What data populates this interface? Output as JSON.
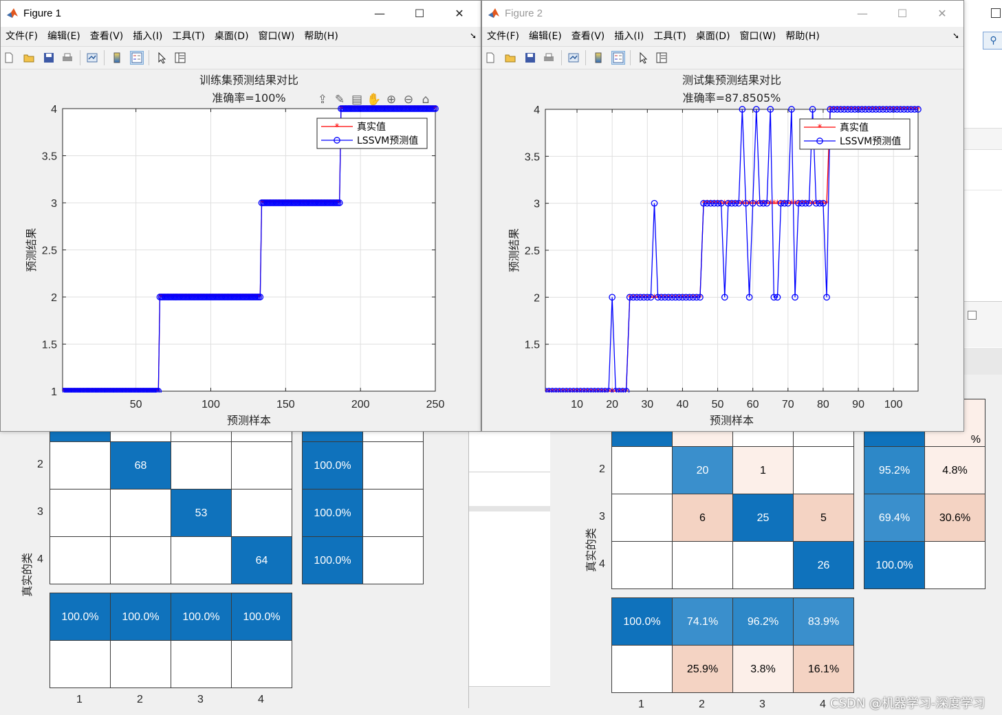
{
  "figure1": {
    "title": "Figure 1",
    "menu": [
      "文件(F)",
      "编辑(E)",
      "查看(V)",
      "插入(I)",
      "工具(T)",
      "桌面(D)",
      "窗口(W)",
      "帮助(H)"
    ],
    "toolbar_icons": [
      "new-figure-icon",
      "open-icon",
      "save-icon",
      "print-icon",
      "link-plot-icon",
      "colorbar-icon",
      "legend-icon",
      "pointer-icon",
      "property-inspector-icon"
    ],
    "axes_toolbar_icons": [
      "export-icon",
      "brush-icon",
      "data-tips-icon",
      "pan-icon",
      "zoom-in-icon",
      "zoom-out-icon",
      "home-icon"
    ],
    "plot_title": "训练集预测结果对比",
    "plot_subtitle": "准确率=100%",
    "xlabel": "预测样本",
    "ylabel": "预测结果",
    "xticks": [
      "50",
      "100",
      "150",
      "200",
      "250"
    ],
    "yticks": [
      "1",
      "1.5",
      "2",
      "2.5",
      "3",
      "3.5",
      "4"
    ],
    "legend": [
      "真实值",
      "LSSVM预测值"
    ]
  },
  "figure2": {
    "title": "Figure 2",
    "menu": [
      "文件(F)",
      "编辑(E)",
      "查看(V)",
      "插入(I)",
      "工具(T)",
      "桌面(D)",
      "窗口(W)",
      "帮助(H)"
    ],
    "toolbar_icons": [
      "new-figure-icon",
      "open-icon",
      "save-icon",
      "print-icon",
      "link-plot-icon",
      "colorbar-icon",
      "legend-icon",
      "pointer-icon",
      "property-inspector-icon"
    ],
    "plot_title": "测试集预测结果对比",
    "plot_subtitle": "准确率=87.8505%",
    "xlabel": "预测样本",
    "ylabel": "预测结果",
    "xticks": [
      "10",
      "20",
      "30",
      "40",
      "50",
      "60",
      "70",
      "80",
      "90",
      "100"
    ],
    "yticks": [
      "1.5",
      "2",
      "2.5",
      "3",
      "3.5",
      "4"
    ],
    "legend": [
      "真实值",
      "LSSVM预测值"
    ]
  },
  "chart_data": [
    {
      "type": "line",
      "title": "训练集预测结果对比",
      "subtitle": "准确率=100%",
      "xlabel": "预测样本",
      "ylabel": "预测结果",
      "xlim": [
        1,
        250
      ],
      "ylim": [
        1,
        4
      ],
      "grid": true,
      "legend_position": "top-right",
      "series_note": "true and predicted identical",
      "segments": [
        {
          "class": 1,
          "x_start": 1,
          "x_end": 65
        },
        {
          "class": 2,
          "x_start": 66,
          "x_end": 133
        },
        {
          "class": 3,
          "x_start": 134,
          "x_end": 186
        },
        {
          "class": 4,
          "x_start": 187,
          "x_end": 250
        }
      ],
      "series": [
        {
          "name": "真实值",
          "color": "#ff0000",
          "marker": "*"
        },
        {
          "name": "LSSVM预测值",
          "color": "#0000ff",
          "marker": "o"
        }
      ]
    },
    {
      "type": "line",
      "title": "测试集预测结果对比",
      "subtitle": "准确率=87.8505%",
      "xlabel": "预测样本",
      "ylabel": "预测结果",
      "xlim": [
        1,
        107
      ],
      "ylim": [
        1,
        4
      ],
      "grid": true,
      "legend_position": "top-right",
      "x": [
        1,
        2,
        3,
        4,
        5,
        6,
        7,
        8,
        9,
        10,
        11,
        12,
        13,
        14,
        15,
        16,
        17,
        18,
        19,
        20,
        21,
        22,
        23,
        24,
        25,
        26,
        27,
        28,
        29,
        30,
        31,
        32,
        33,
        34,
        35,
        36,
        37,
        38,
        39,
        40,
        41,
        42,
        43,
        44,
        45,
        46,
        47,
        48,
        49,
        50,
        51,
        52,
        53,
        54,
        55,
        56,
        57,
        58,
        59,
        60,
        61,
        62,
        63,
        64,
        65,
        66,
        67,
        68,
        69,
        70,
        71,
        72,
        73,
        74,
        75,
        76,
        77,
        78,
        79,
        80,
        81,
        82,
        83,
        84,
        85,
        86,
        87,
        88,
        89,
        90,
        91,
        92,
        93,
        94,
        95,
        96,
        97,
        98,
        99,
        100,
        101,
        102,
        103,
        104,
        105,
        106,
        107
      ],
      "series": [
        {
          "name": "真实值",
          "color": "#ff0000",
          "marker": "*",
          "values": [
            1,
            1,
            1,
            1,
            1,
            1,
            1,
            1,
            1,
            1,
            1,
            1,
            1,
            1,
            1,
            1,
            1,
            1,
            1,
            1,
            1,
            1,
            1,
            1,
            2,
            2,
            2,
            2,
            2,
            2,
            2,
            2,
            2,
            2,
            2,
            2,
            2,
            2,
            2,
            2,
            2,
            2,
            2,
            2,
            2,
            3,
            3,
            3,
            3,
            3,
            3,
            3,
            3,
            3,
            3,
            3,
            3,
            3,
            3,
            3,
            3,
            3,
            3,
            3,
            3,
            3,
            3,
            3,
            3,
            3,
            3,
            3,
            3,
            3,
            3,
            3,
            3,
            3,
            3,
            3,
            3,
            4,
            4,
            4,
            4,
            4,
            4,
            4,
            4,
            4,
            4,
            4,
            4,
            4,
            4,
            4,
            4,
            4,
            4,
            4,
            4,
            4,
            4,
            4,
            4,
            4,
            4
          ]
        },
        {
          "name": "LSSVM预测值",
          "color": "#0000ff",
          "marker": "o",
          "values": [
            1,
            1,
            1,
            1,
            1,
            1,
            1,
            1,
            1,
            1,
            1,
            1,
            1,
            1,
            1,
            1,
            1,
            1,
            1,
            2,
            1,
            1,
            1,
            1,
            2,
            2,
            2,
            2,
            2,
            2,
            2,
            3,
            2,
            2,
            2,
            2,
            2,
            2,
            2,
            2,
            2,
            2,
            2,
            2,
            2,
            3,
            3,
            3,
            3,
            3,
            3,
            2,
            3,
            3,
            3,
            3,
            4,
            3,
            2,
            3,
            4,
            3,
            3,
            3,
            4,
            2,
            2,
            3,
            3,
            3,
            4,
            2,
            3,
            3,
            3,
            3,
            4,
            3,
            3,
            3,
            2,
            4,
            4,
            4,
            4,
            4,
            4,
            4,
            4,
            4,
            4,
            4,
            4,
            4,
            4,
            4,
            4,
            4,
            4,
            4,
            4,
            4,
            4,
            4,
            4,
            4,
            4
          ]
        }
      ]
    },
    {
      "type": "heatmap",
      "ylabel": "真实的类",
      "row_labels": [
        "2",
        "3",
        "4"
      ],
      "col_labels": [
        "1",
        "2",
        "3",
        "4"
      ],
      "cells": [
        [
          "",
          "68",
          "",
          ""
        ],
        [
          "",
          "",
          "53",
          ""
        ],
        [
          "",
          "",
          "",
          "64"
        ]
      ],
      "row_summary": [
        [
          "100.0%",
          ""
        ],
        [
          "100.0%",
          ""
        ],
        [
          "100.0%",
          ""
        ]
      ],
      "col_summary": [
        [
          "100.0%",
          "100.0%",
          "100.0%",
          "100.0%"
        ],
        [
          "",
          "",
          "",
          ""
        ]
      ]
    },
    {
      "type": "heatmap",
      "ylabel": "真实的类",
      "row_labels": [
        "2",
        "3",
        "4"
      ],
      "col_labels": [
        "1",
        "2",
        "3",
        "4"
      ],
      "top_right_fragment": "%",
      "cells": [
        [
          "",
          "20",
          "1",
          ""
        ],
        [
          "",
          "6",
          "25",
          "5"
        ],
        [
          "",
          "",
          "",
          "26"
        ]
      ],
      "row_summary": [
        [
          "95.2%",
          "4.8%"
        ],
        [
          "69.4%",
          "30.6%"
        ],
        [
          "100.0%",
          ""
        ]
      ],
      "col_summary": [
        [
          "100.0%",
          "74.1%",
          "96.2%",
          "83.9%"
        ],
        [
          "",
          "25.9%",
          "3.8%",
          "16.1%"
        ]
      ]
    }
  ],
  "watermark": "CSDN @机器学习-深度学习",
  "colors": {
    "cm_dark_blue": "#0f72bc",
    "cm_mid_blue": "#3a8fcc",
    "cm_light_blue": "#2d88c8",
    "cm_salmon": "#f4d3c3",
    "cm_pale": "#fcefe9",
    "true_line": "#ff0000",
    "pred_line": "#0000ff"
  }
}
